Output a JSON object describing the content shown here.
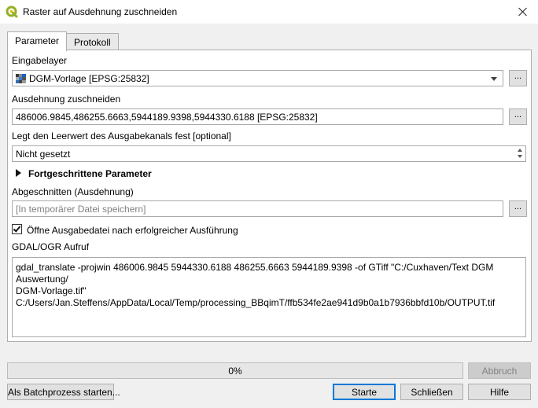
{
  "window": {
    "title": "Raster auf Ausdehnung zuschneiden",
    "icon": "qgis-logo-icon",
    "close_icon": "close-icon"
  },
  "tabs": [
    {
      "label": "Parameter",
      "active": true
    },
    {
      "label": "Protokoll",
      "active": false
    }
  ],
  "params": {
    "input_layer_label": "Eingabelayer",
    "input_layer_value": "DGM-Vorlage [EPSG:25832]",
    "extent_label": "Ausdehnung zuschneiden",
    "extent_value": "486006.9845,486255.6663,5944189.9398,5944330.6188 [EPSG:25832]",
    "nodata_label": "Legt den Leerwert des Ausgabekanals fest [optional]",
    "nodata_value": "Nicht gesetzt",
    "advanced_label": "Fortgeschrittene Parameter",
    "output_label": "Abgeschnitten (Ausdehnung)",
    "output_placeholder": "[In temporärer Datei speichern]",
    "open_output_label": "Öffne Ausgabedatei nach erfolgreicher Ausführung",
    "open_output_checked": true,
    "gdal_label": "GDAL/OGR Aufruf",
    "gdal_command": "gdal_translate -projwin 486006.9845 5944330.6188 486255.6663 5944189.9398 -of GTiff \"C:/Cuxhaven/Text DGM Auswertung/\nDGM-Vorlage.tif\" C:/Users/Jan.Steffens/AppData/Local/Temp/processing_BBqimT/ffb534fe2ae941d9b0a1b7936bbfd10b/OUTPUT.tif",
    "browse_label": "...",
    "browse_menu_label": "..."
  },
  "footer": {
    "progress_text": "0%",
    "progress_value": 0,
    "cancel_label": "Abbruch",
    "batch_label": "Als Batchprozess starten...",
    "start_label": "Starte",
    "close_label": "Schließen",
    "help_label": "Hilfe"
  },
  "colors": {
    "accent": "#0078d7",
    "qgis_green": "#93b023"
  }
}
